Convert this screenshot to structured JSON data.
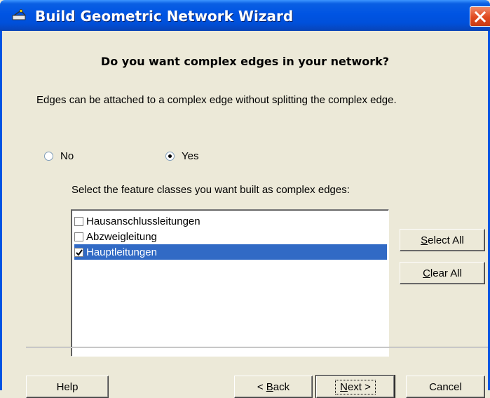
{
  "window": {
    "title": "Build Geometric Network Wizard",
    "title_icon": "network-wizard-icon",
    "accent": "#0054e3",
    "close_icon": "close-icon"
  },
  "content": {
    "question": "Do you want complex edges in your network?",
    "description": "Edges can be attached to a complex edge without splitting the complex edge.",
    "radio_no": {
      "label": "No",
      "checked": false
    },
    "radio_yes": {
      "label": "Yes",
      "checked": true
    },
    "select_label": "Select the feature classes you want built as complex edges:"
  },
  "feature_classes": [
    {
      "label": "Hausanschlussleitungen",
      "checked": false,
      "selected": false
    },
    {
      "label": "Abzweigleitung",
      "checked": false,
      "selected": false
    },
    {
      "label": "Hauptleitungen",
      "checked": true,
      "selected": true
    }
  ],
  "side_buttons": {
    "select_all": {
      "mnemonic": "S",
      "rest": "elect All"
    },
    "clear_all": {
      "mnemonic": "C",
      "rest": "lear All"
    }
  },
  "footer": {
    "help": "Help",
    "back": {
      "prefix": "< ",
      "mnemonic": "B",
      "rest": "ack"
    },
    "next": {
      "mnemonic": "N",
      "rest": "ext >"
    },
    "cancel": "Cancel"
  },
  "selection_color": "#316ac5"
}
